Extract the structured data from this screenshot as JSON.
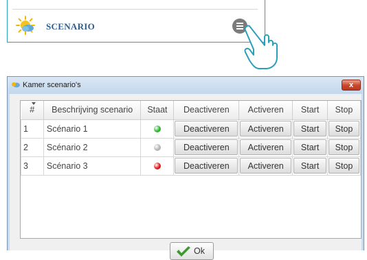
{
  "widget": {
    "title": "SCENARIO",
    "icon": "sun-cloud-icon",
    "menu_icon": "menu-icon",
    "hand_icon": "hand-pointer-icon"
  },
  "dialog": {
    "title": "Kamer scenario's",
    "close_label": "x",
    "columns": [
      "#",
      "Beschrijving scenario",
      "Staat",
      "Deactiveren",
      "Activeren",
      "Start",
      "Stop"
    ],
    "rows": [
      {
        "num": "1",
        "description": "Scénario 1",
        "state": "active",
        "state_color": "#2db52d",
        "deactivate": "Deactiveren",
        "activate": "Activeren",
        "start": "Start",
        "stop": "Stop"
      },
      {
        "num": "2",
        "description": "Scénario 2",
        "state": "inactive",
        "state_color": "#b4b4b4",
        "deactivate": "Deactiveren",
        "activate": "Activeren",
        "start": "Start",
        "stop": "Stop"
      },
      {
        "num": "3",
        "description": "Scénario 3",
        "state": "error",
        "state_color": "#e01818",
        "deactivate": "Deactiveren",
        "activate": "Activeren",
        "start": "Start",
        "stop": "Stop"
      }
    ],
    "ok_label": "Ok"
  },
  "colors": {
    "accent_border": "#2a9fb8",
    "title_text": "#2e5d8c",
    "window_frame": "#c9dcef",
    "check_green": "#3a9a2a"
  }
}
